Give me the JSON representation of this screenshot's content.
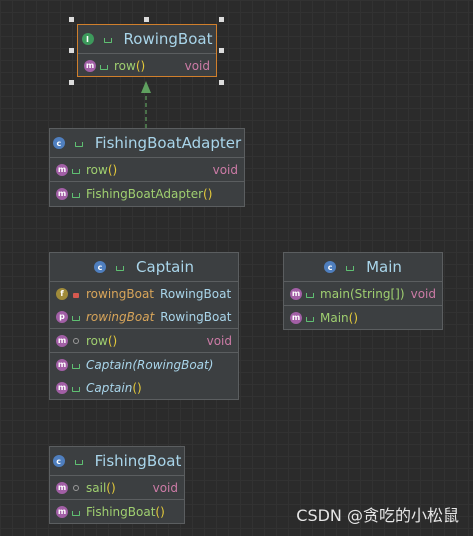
{
  "colors": {
    "background": "#2b2b2b",
    "box_fill": "#3c3f41",
    "selected_border": "#d07f2c",
    "title": "#a9d5ea",
    "member_name": "#9fcf70",
    "return_type": "#cc7ba6",
    "arrow": "#5fa05f"
  },
  "boxes": {
    "rowing_boat": {
      "title": "RowingBoat",
      "kind_icon": "interface-icon",
      "members": [
        {
          "name": "row",
          "parens": "()",
          "return": "void",
          "badge": "m"
        }
      ]
    },
    "fishing_boat_adapter": {
      "title": "FishingBoatAdapter",
      "kind_icon": "class-icon",
      "members": [
        {
          "name": "row",
          "parens": "()",
          "return": "void",
          "badge": "m"
        }
      ],
      "constructors": [
        {
          "name": "FishingBoatAdapter",
          "parens": "()",
          "badge": "m"
        }
      ]
    },
    "captain": {
      "title": "Captain",
      "kind_icon": "class-icon",
      "fields": [
        {
          "name": "rowingBoat",
          "type": "RowingBoat",
          "badge": "f"
        },
        {
          "name": "rowingBoat",
          "type": "RowingBoat",
          "badge": "p"
        }
      ],
      "members": [
        {
          "name": "row",
          "parens": "()",
          "return": "void",
          "badge": "m"
        }
      ],
      "constructors": [
        {
          "name": "Captain(RowingBoat)",
          "badge": "m"
        },
        {
          "name": "Captain",
          "parens": "()",
          "badge": "m"
        }
      ]
    },
    "main": {
      "title": "Main",
      "kind_icon": "class-icon",
      "members": [
        {
          "name": "main(String[])",
          "return": "void",
          "badge": "m"
        }
      ],
      "constructors": [
        {
          "name": "Main",
          "parens": "()",
          "badge": "m"
        }
      ]
    },
    "fishing_boat": {
      "title": "FishingBoat",
      "kind_icon": "class-icon",
      "members": [
        {
          "name": "sail",
          "parens": "()",
          "return": "void",
          "badge": "m"
        }
      ],
      "constructors": [
        {
          "name": "FishingBoat",
          "parens": "()",
          "badge": "m"
        }
      ]
    }
  },
  "relations": [
    {
      "from": "FishingBoatAdapter",
      "to": "RowingBoat",
      "type": "implements"
    }
  ],
  "watermark": "CSDN @贪吃的小松鼠"
}
